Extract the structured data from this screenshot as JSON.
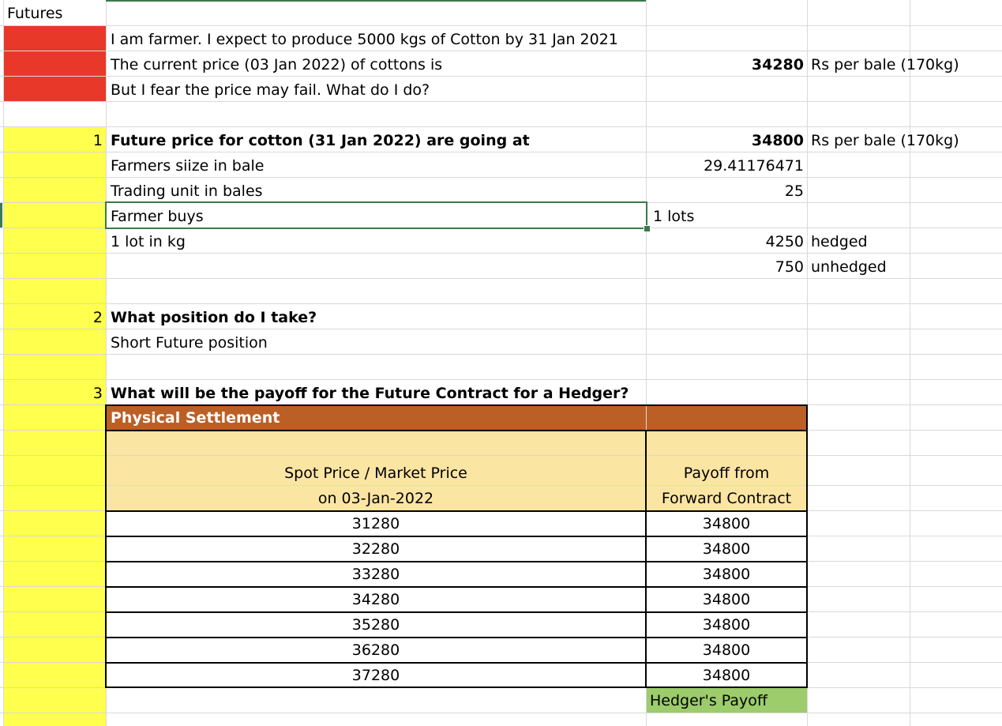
{
  "sheet": {
    "title": "Futures",
    "intro": {
      "line1": "I am farmer. I expect to produce 5000 kgs of Cotton by 31 Jan 2021",
      "line2": "The current price (03 Jan 2022) of cottons is",
      "line2_value": "34280",
      "line2_unit": "Rs per bale (170kg)",
      "line3": "But I fear the price may fail. What do I do?"
    },
    "q1": {
      "num": "1",
      "label": "Future price for cotton (31 Jan 2022) are going at",
      "value": "34800",
      "unit": "Rs per bale (170kg)",
      "rows": [
        {
          "label": "Farmers siize in bale",
          "value": "29.41176471"
        },
        {
          "label": "Trading unit in bales",
          "value": "25"
        },
        {
          "label": "Farmer buys",
          "value": "1 lots"
        },
        {
          "label": "1 lot in kg",
          "value": "4250",
          "note": "hedged"
        }
      ],
      "unhedged_value": "750",
      "unhedged_note": "unhedged"
    },
    "q2": {
      "num": "2",
      "label": "What position do I take?",
      "answer": "Short Future position"
    },
    "q3": {
      "num": "3",
      "label": "What will be the payoff for the Future Contract for a Hedger?"
    },
    "table": {
      "title": "Physical Settlement",
      "col1_header_line1": "Spot Price / Market Price",
      "col1_header_line2": "on 03-Jan-2022",
      "col2_header_line1": "Payoff from",
      "col2_header_line2": "Forward Contract",
      "rows": [
        {
          "spot": "31280",
          "payoff": "34800"
        },
        {
          "spot": "32280",
          "payoff": "34800"
        },
        {
          "spot": "33280",
          "payoff": "34800"
        },
        {
          "spot": "34280",
          "payoff": "34800"
        },
        {
          "spot": "35280",
          "payoff": "34800"
        },
        {
          "spot": "36280",
          "payoff": "34800"
        },
        {
          "spot": "37280",
          "payoff": "34800"
        }
      ],
      "footer": "Hedger's Payoff"
    },
    "colors": {
      "red": "#e8382a",
      "yellow": "#ffff4d",
      "header_brown": "#bb5f27",
      "header_tan": "#fbe5a3",
      "footer_green": "#9ccc6b",
      "selection": "#3b7a4a"
    }
  }
}
